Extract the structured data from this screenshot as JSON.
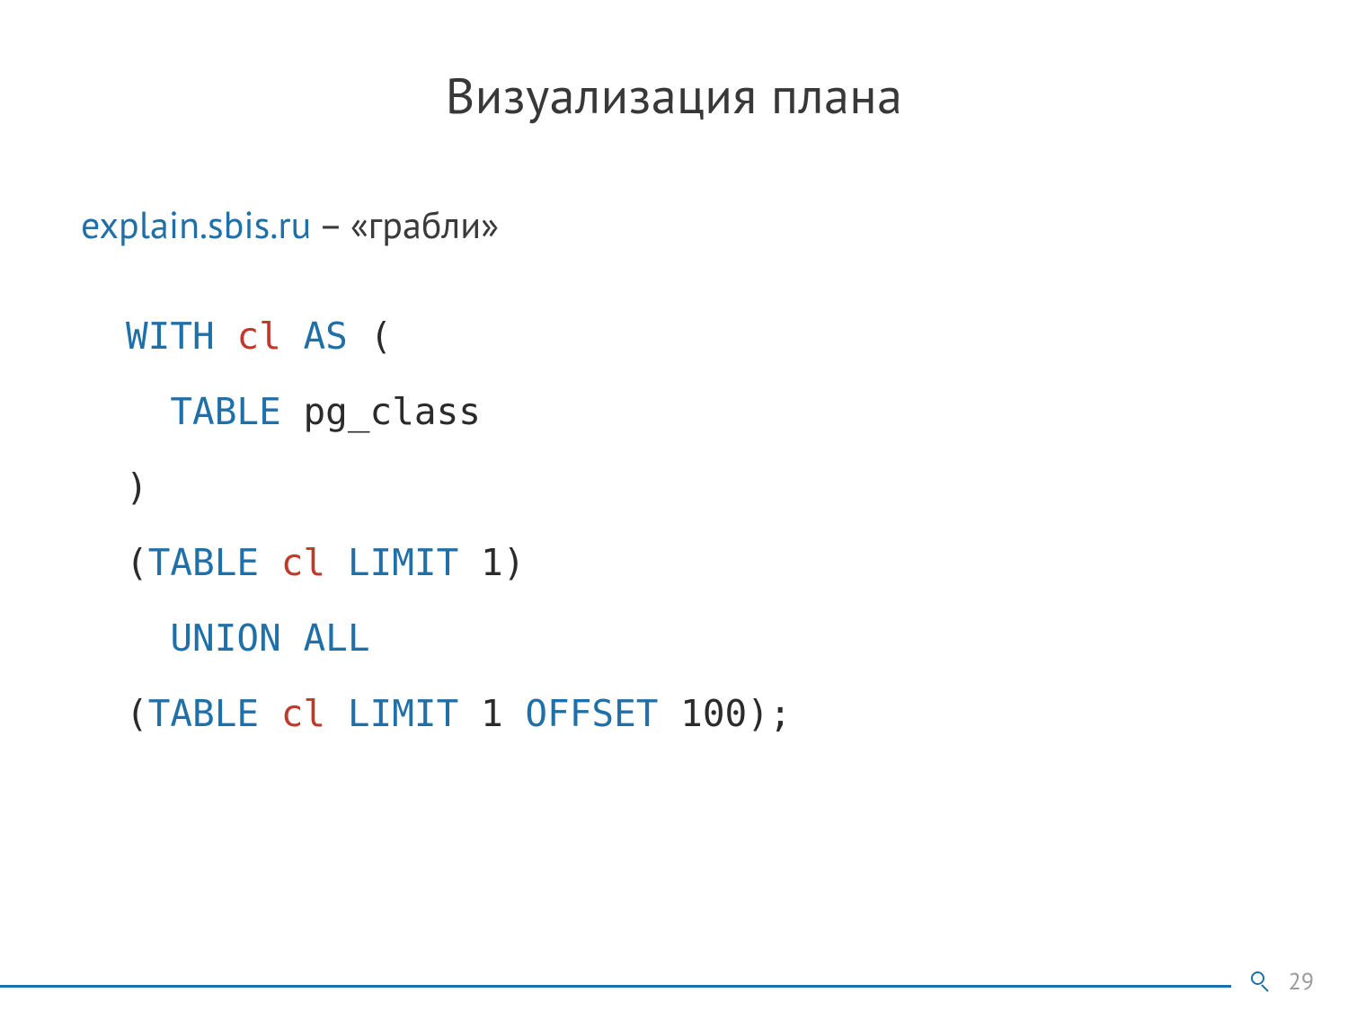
{
  "title": "Визуализация плана",
  "subtitle": {
    "link": "explain.sbis.ru",
    "dash": " – ",
    "desc": "«грабли»"
  },
  "code": {
    "l1_kw1": "WITH",
    "l1_cte": "cl",
    "l1_kw2": "AS",
    "l1_p": " (",
    "l2_kw": "TABLE",
    "l2_id": " pg_class",
    "l3": ")",
    "l4_p1": "(",
    "l4_kw1": "TABLE",
    "l4_cte": "cl",
    "l4_kw2": "LIMIT",
    "l4_t": " 1)",
    "l5_kw": "UNION ALL",
    "l6_p1": "(",
    "l6_kw1": "TABLE",
    "l6_cte": "cl",
    "l6_kw2": "LIMIT",
    "l6_mid": " 1 ",
    "l6_kw3": "OFFSET",
    "l6_t": " 100);"
  },
  "page": "29"
}
